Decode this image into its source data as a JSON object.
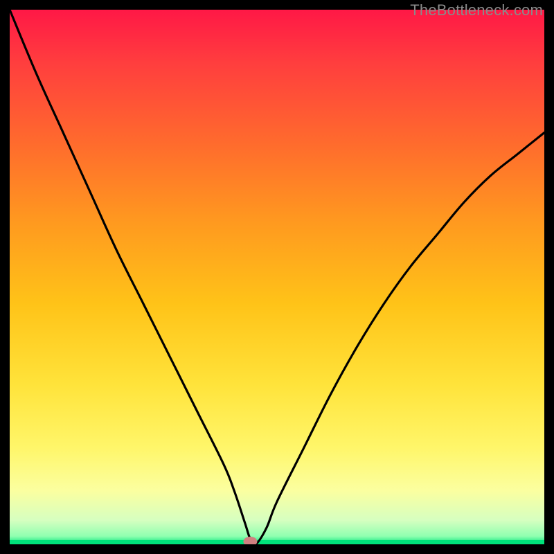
{
  "watermark": "TheBottleneck.com",
  "chart_data": {
    "type": "line",
    "title": "",
    "xlabel": "",
    "ylabel": "",
    "xlim": [
      0,
      100
    ],
    "ylim": [
      0,
      100
    ],
    "series": [
      {
        "name": "curve",
        "x": [
          0,
          5,
          10,
          15,
          20,
          25,
          30,
          35,
          40,
          42,
          44,
          45,
          46,
          48,
          50,
          55,
          60,
          65,
          70,
          75,
          80,
          85,
          90,
          95,
          100
        ],
        "values": [
          100,
          88,
          77,
          66,
          55,
          45,
          35,
          25,
          15,
          10,
          4,
          1,
          0,
          3,
          8,
          18,
          28,
          37,
          45,
          52,
          58,
          64,
          69,
          73,
          77
        ]
      }
    ],
    "marker": {
      "x": 45,
      "y": 0,
      "color": "#d08080"
    },
    "baseline_color": "#00e37a",
    "gradient_stops": [
      {
        "offset": 0.0,
        "color": "#ff1846"
      },
      {
        "offset": 0.1,
        "color": "#ff3e3e"
      },
      {
        "offset": 0.25,
        "color": "#ff6b2d"
      },
      {
        "offset": 0.4,
        "color": "#ff9a1f"
      },
      {
        "offset": 0.55,
        "color": "#ffc318"
      },
      {
        "offset": 0.7,
        "color": "#ffe33a"
      },
      {
        "offset": 0.82,
        "color": "#fff66a"
      },
      {
        "offset": 0.9,
        "color": "#fbffa0"
      },
      {
        "offset": 0.955,
        "color": "#d6ffc0"
      },
      {
        "offset": 0.985,
        "color": "#8fffb0"
      },
      {
        "offset": 1.0,
        "color": "#00e37a"
      }
    ]
  }
}
